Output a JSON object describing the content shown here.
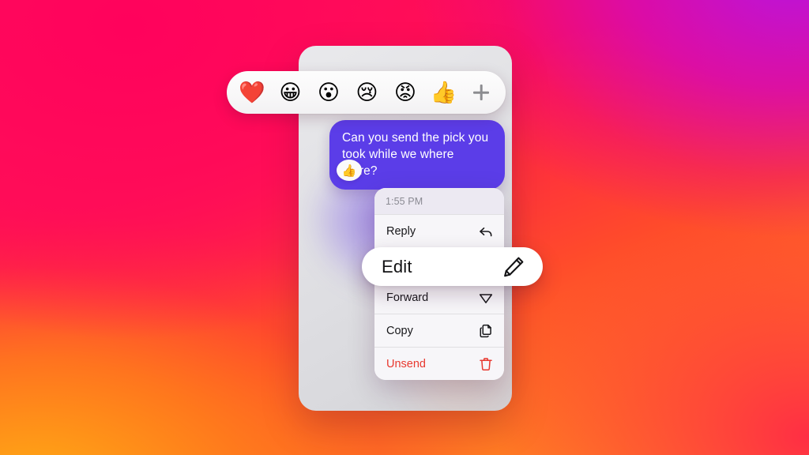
{
  "theme": {
    "bg_pink": "#FF0A5F",
    "bg_magenta": "#BA14DC",
    "bg_orange": "#FFAC14",
    "bg_red": "#FF2846",
    "bubble_purple": "#5B3DE8",
    "destructive_red": "#E8382F",
    "menu_surface": "#F7F6F9",
    "phone_surface": "#E3E3E6"
  },
  "reaction_bar": {
    "name": "emoji-reaction-bar",
    "reactions": [
      {
        "icon": "heart-emoji",
        "glyph": "❤️",
        "label": "Heart"
      },
      {
        "icon": "grinning-face-emoji",
        "glyph": "😀",
        "label": "Grinning face"
      },
      {
        "icon": "surprised-face-emoji",
        "glyph": "😮",
        "label": "Surprised face"
      },
      {
        "icon": "crying-face-emoji",
        "glyph": "😢",
        "label": "Crying face"
      },
      {
        "icon": "angry-face-emoji",
        "glyph": "😡",
        "label": "Angry face"
      },
      {
        "icon": "thumbs-up-emoji",
        "glyph": "👍",
        "label": "Thumbs up"
      }
    ],
    "add_button": {
      "icon": "plus-icon",
      "label": "More reactions"
    }
  },
  "conversation": {
    "message": {
      "text": "Can you send the pick you took while we where there?",
      "sender": "outgoing",
      "reaction": {
        "icon": "thumbs-up-emoji",
        "glyph": "👍",
        "label": "Thumbs up reaction"
      }
    }
  },
  "context_menu": {
    "timestamp": "1:55 PM",
    "items": [
      {
        "label": "Reply",
        "icon": "reply-arrow-icon",
        "destructive": false,
        "highlighted": false
      },
      {
        "label": "Edit",
        "icon": "pencil-icon",
        "destructive": false,
        "highlighted": true
      },
      {
        "label": "Forward",
        "icon": "send-arrow-icon",
        "destructive": false,
        "highlighted": false
      },
      {
        "label": "Copy",
        "icon": "copy-documents-icon",
        "destructive": false,
        "highlighted": false
      },
      {
        "label": "Unsend",
        "icon": "trash-icon",
        "destructive": true,
        "highlighted": false
      }
    ]
  }
}
